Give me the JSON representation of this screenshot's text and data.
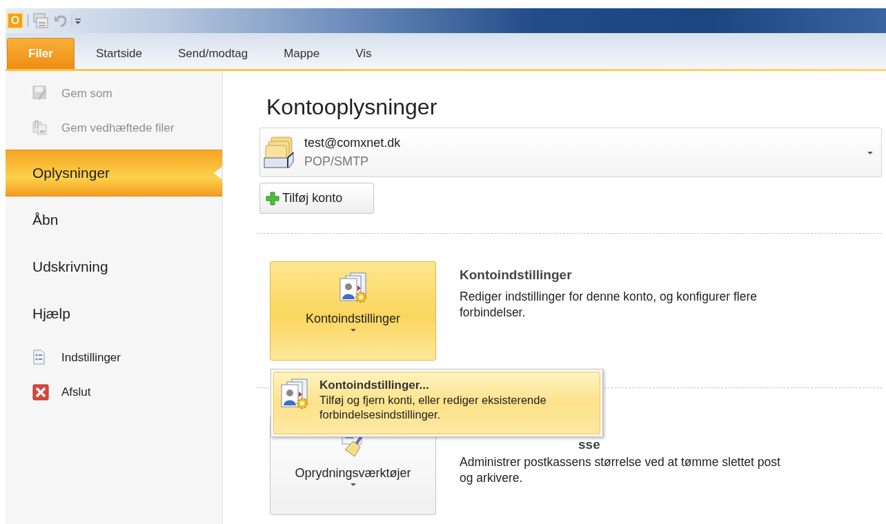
{
  "quick_access": {
    "app_letter": "O"
  },
  "tabs": [
    {
      "label": "Filer",
      "selected": true
    },
    {
      "label": "Startside",
      "selected": false
    },
    {
      "label": "Send/modtag",
      "selected": false
    },
    {
      "label": "Mappe",
      "selected": false
    },
    {
      "label": "Vis",
      "selected": false
    }
  ],
  "nav": {
    "items": [
      {
        "label": "Gem som",
        "kind": "command",
        "selected": false,
        "disabled": true
      },
      {
        "label": "Gem vedhæftede filer",
        "kind": "command",
        "selected": false,
        "disabled": true
      },
      {
        "label": "Oplysninger",
        "kind": "page",
        "selected": true,
        "disabled": false
      },
      {
        "label": "Åbn",
        "kind": "page",
        "selected": false,
        "disabled": false
      },
      {
        "label": "Udskrivning",
        "kind": "page",
        "selected": false,
        "disabled": false
      },
      {
        "label": "Hjælp",
        "kind": "page",
        "selected": false,
        "disabled": false
      },
      {
        "label": "Indstillinger",
        "kind": "command",
        "selected": false,
        "disabled": false
      },
      {
        "label": "Afslut",
        "kind": "command",
        "selected": false,
        "disabled": false
      }
    ]
  },
  "title": "Kontooplysninger",
  "account": {
    "email": "test@comxnet.dk",
    "type": "POP/SMTP"
  },
  "add_account_button": "Tilføj konto",
  "sections": [
    {
      "button_label": "Kontoindstillinger",
      "heading": "Kontoindstillinger",
      "description": "Rediger indstillinger for denne konto, og konfigurer flere forbindelser.",
      "highlighted": true
    },
    {
      "button_label": "Oprydningsværktøjer",
      "heading": "sse",
      "description": "Administrer postkassens størrelse ved at tømme slettet post og arkivere.",
      "highlighted": false
    }
  ],
  "dropdown_menu": {
    "items": [
      {
        "title": "Kontoindstillinger...",
        "description": "Tilføj og fjern konti, eller rediger eksisterende forbindelsesindstillinger.",
        "selected": true
      }
    ]
  }
}
